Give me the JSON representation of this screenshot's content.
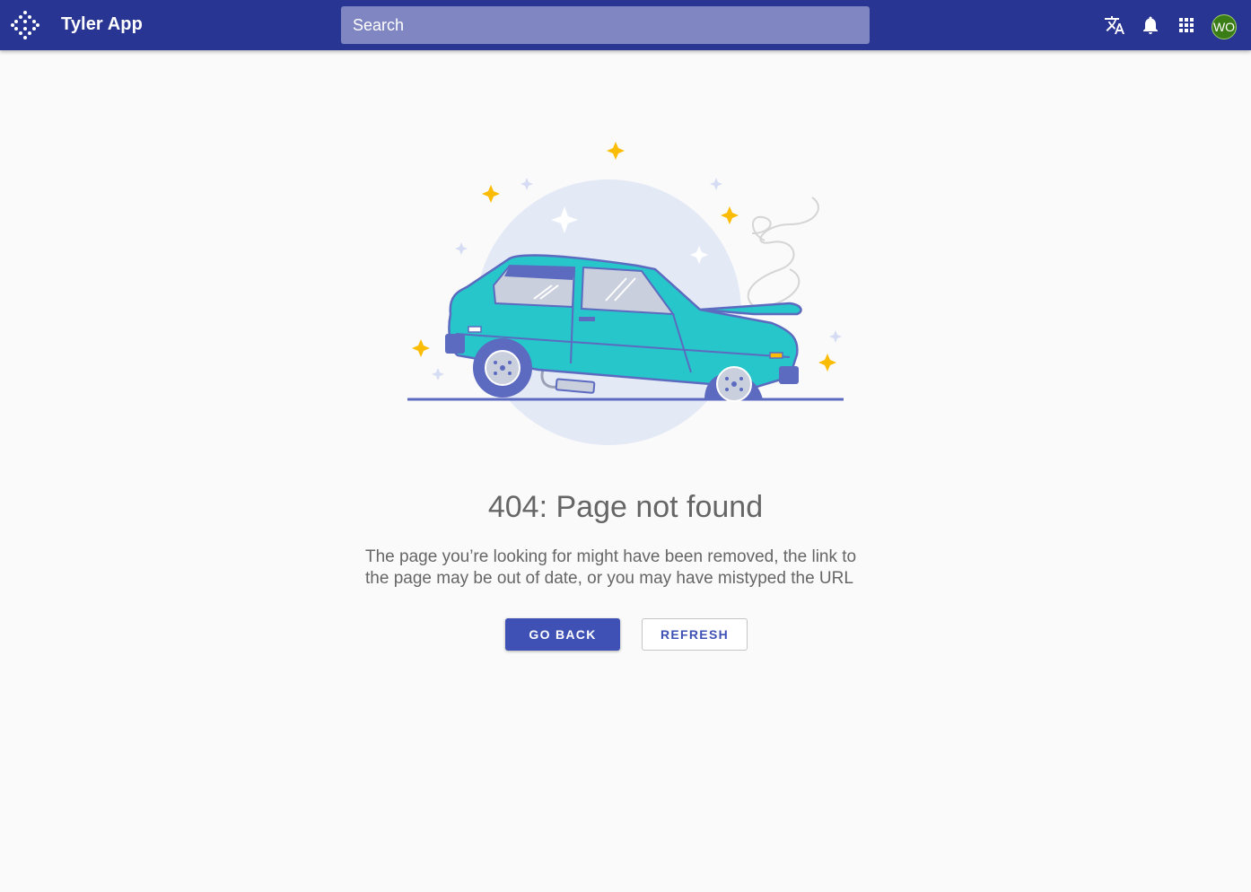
{
  "header": {
    "app_title": "Tyler App",
    "search_placeholder": "Search",
    "search_value": "",
    "avatar_initials": "WO",
    "colors": {
      "bar": "#283593",
      "search": "#7f86c1",
      "avatar": "#3a7d16"
    },
    "icons": [
      "app-logo-icon",
      "translate-icon",
      "notifications-bell-icon",
      "apps-grid-icon"
    ]
  },
  "error": {
    "title": "404: Page not found",
    "message_line1": "The page you’re looking for might have been removed, the link to",
    "message_line2": "the page may be out of date, or you may have mistyped the URL",
    "illustration": "broken-down-car-illustration"
  },
  "actions": {
    "go_back_label": "GO BACK",
    "refresh_label": "REFRESH",
    "accent_color": "#3f51b5"
  }
}
